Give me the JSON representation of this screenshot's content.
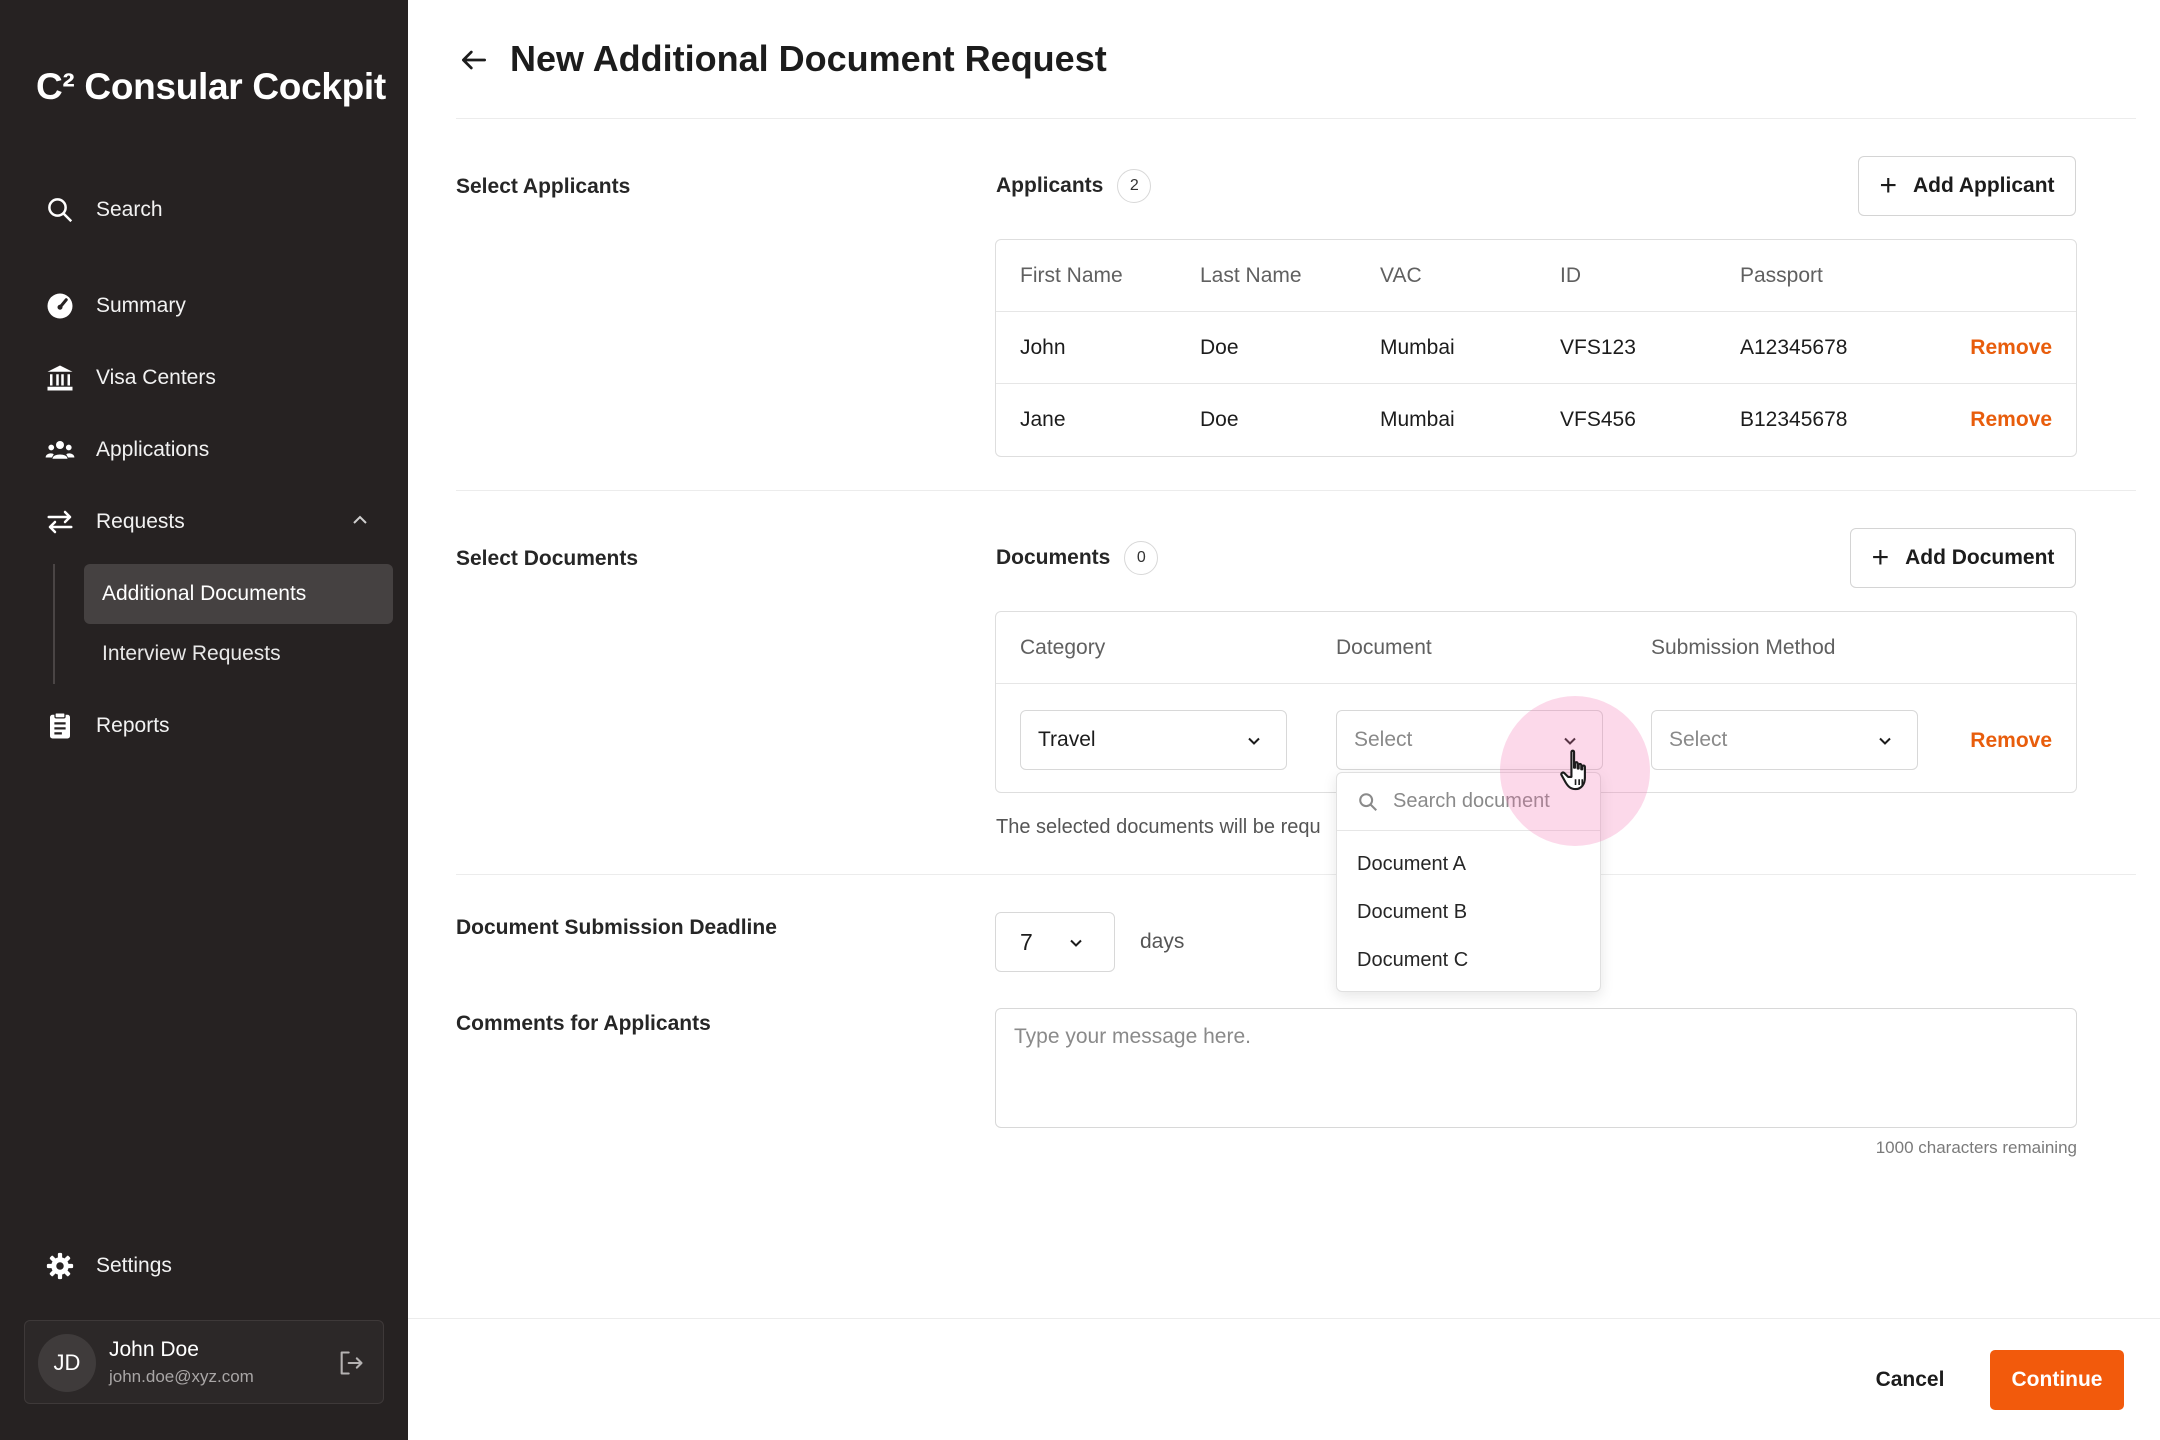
{
  "brand": {
    "name": "C² Consular Cockpit"
  },
  "sidebar": {
    "items": [
      {
        "label": "Search",
        "icon": "search-icon"
      },
      {
        "label": "Summary",
        "icon": "speedometer-icon"
      },
      {
        "label": "Visa Centers",
        "icon": "bank-icon"
      },
      {
        "label": "Applications",
        "icon": "users-icon"
      },
      {
        "label": "Requests",
        "icon": "swap-icon",
        "expanded": true
      },
      {
        "label": "Reports",
        "icon": "clipboard-icon"
      }
    ],
    "sub_items": [
      {
        "label": "Additional Documents",
        "active": true
      },
      {
        "label": "Interview Requests",
        "active": false
      }
    ],
    "settings_label": "Settings",
    "user": {
      "initials": "JD",
      "name": "John Doe",
      "email": "john.doe@xyz.com"
    }
  },
  "page": {
    "title": "New Additional Document Request"
  },
  "applicants": {
    "section_label": "Select Applicants",
    "heading": "Applicants",
    "count": "2",
    "add_button": "Add Applicant",
    "columns": [
      "First Name",
      "Last Name",
      "VAC",
      "ID",
      "Passport"
    ],
    "rows": [
      {
        "first": "John",
        "last": "Doe",
        "vac": "Mumbai",
        "id": "VFS123",
        "passport": "A12345678",
        "action": "Remove"
      },
      {
        "first": "Jane",
        "last": "Doe",
        "vac": "Mumbai",
        "id": "VFS456",
        "passport": "B12345678",
        "action": "Remove"
      }
    ]
  },
  "documents": {
    "section_label": "Select Documents",
    "heading": "Documents",
    "count": "0",
    "add_button": "Add Document",
    "columns": [
      "Category",
      "Document",
      "Submission Method"
    ],
    "row": {
      "category": "Travel",
      "document_placeholder": "Select",
      "method_placeholder": "Select",
      "action": "Remove"
    },
    "helper": "The selected documents will be requ",
    "dropdown": {
      "search_placeholder": "Search document",
      "options": [
        "Document A",
        "Document B",
        "Document C"
      ]
    }
  },
  "deadline": {
    "label": "Document Submission Deadline",
    "value": "7",
    "unit": "days"
  },
  "comments": {
    "label": "Comments for Applicants",
    "placeholder": "Type your message here.",
    "remaining": "1000 characters remaining"
  },
  "footer": {
    "cancel": "Cancel",
    "continue": "Continue"
  },
  "colors": {
    "sidebar": "#262222",
    "accent": "#f25a0c",
    "remove": "#e85d0c",
    "active_item": "#454141"
  }
}
